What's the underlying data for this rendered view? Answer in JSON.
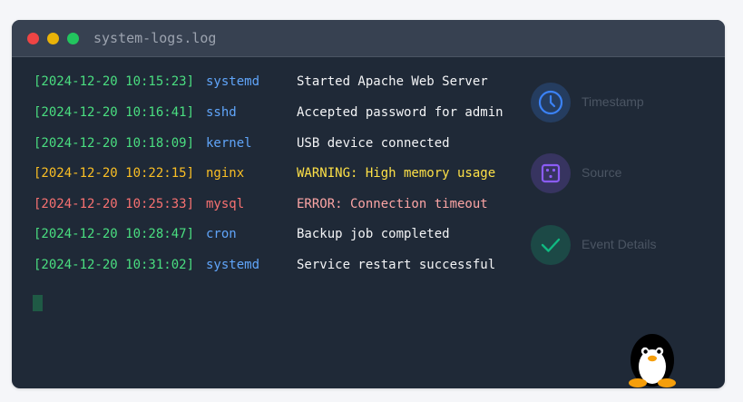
{
  "window": {
    "title": "system-logs.log"
  },
  "logs": [
    {
      "timestamp": "[2024-12-20 10:15:23]",
      "source": "systemd",
      "message": "Started Apache Web Server",
      "level": "info"
    },
    {
      "timestamp": "[2024-12-20 10:16:41]",
      "source": "sshd",
      "message": "Accepted password for admin",
      "level": "info"
    },
    {
      "timestamp": "[2024-12-20 10:18:09]",
      "source": "kernel",
      "message": "USB device connected",
      "level": "info"
    },
    {
      "timestamp": "[2024-12-20 10:22:15]",
      "source": "nginx",
      "message": "WARNING: High memory usage",
      "level": "warn"
    },
    {
      "timestamp": "[2024-12-20 10:25:33]",
      "source": "mysql",
      "message": "ERROR: Connection timeout",
      "level": "error"
    },
    {
      "timestamp": "[2024-12-20 10:28:47]",
      "source": "cron",
      "message": "Backup job completed",
      "level": "info"
    },
    {
      "timestamp": "[2024-12-20 10:31:02]",
      "source": "systemd",
      "message": "Service restart successful",
      "level": "info"
    }
  ],
  "legend": {
    "timestamp": {
      "label": "Timestamp",
      "icon": "clock-icon",
      "color": "#3b82f6"
    },
    "source": {
      "label": "Source",
      "icon": "dice-icon",
      "color": "#8b5cf6"
    },
    "details": {
      "label": "Event Details",
      "icon": "check-icon",
      "color": "#10b981"
    }
  },
  "colors": {
    "background": "#1f2937",
    "titlebar": "#374151",
    "info": "#4ade80",
    "source": "#60a5fa",
    "warn": "#fbbf24",
    "error": "#f87171"
  },
  "mascot": {
    "icon": "penguin-icon"
  }
}
